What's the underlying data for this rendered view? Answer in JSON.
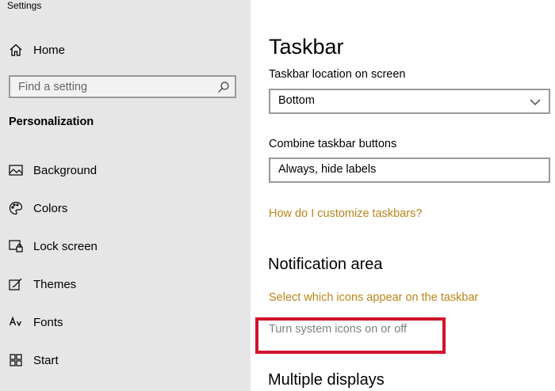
{
  "window": {
    "title": "Settings"
  },
  "sidebar": {
    "home_label": "Home",
    "search_placeholder": "Find a setting",
    "section_label": "Personalization",
    "items": [
      {
        "label": "Background",
        "icon": "image-icon"
      },
      {
        "label": "Colors",
        "icon": "palette-icon"
      },
      {
        "label": "Lock screen",
        "icon": "lock-screen-icon"
      },
      {
        "label": "Themes",
        "icon": "themes-icon"
      },
      {
        "label": "Fonts",
        "icon": "fonts-icon"
      },
      {
        "label": "Start",
        "icon": "start-icon"
      }
    ]
  },
  "main": {
    "title": "Taskbar",
    "location_label": "Taskbar location on screen",
    "location_value": "Bottom",
    "combine_label": "Combine taskbar buttons",
    "combine_value": "Always, hide labels",
    "customize_link": "How do I customize taskbars?",
    "notification_heading": "Notification area",
    "select_icons_link": "Select which icons appear on the taskbar",
    "system_icons_link": "Turn system icons on or off",
    "multiple_displays_heading": "Multiple displays"
  },
  "colors": {
    "sidebar_bg": "#e6e6e6",
    "link": "#b9851a",
    "highlight": "#d0132b"
  }
}
